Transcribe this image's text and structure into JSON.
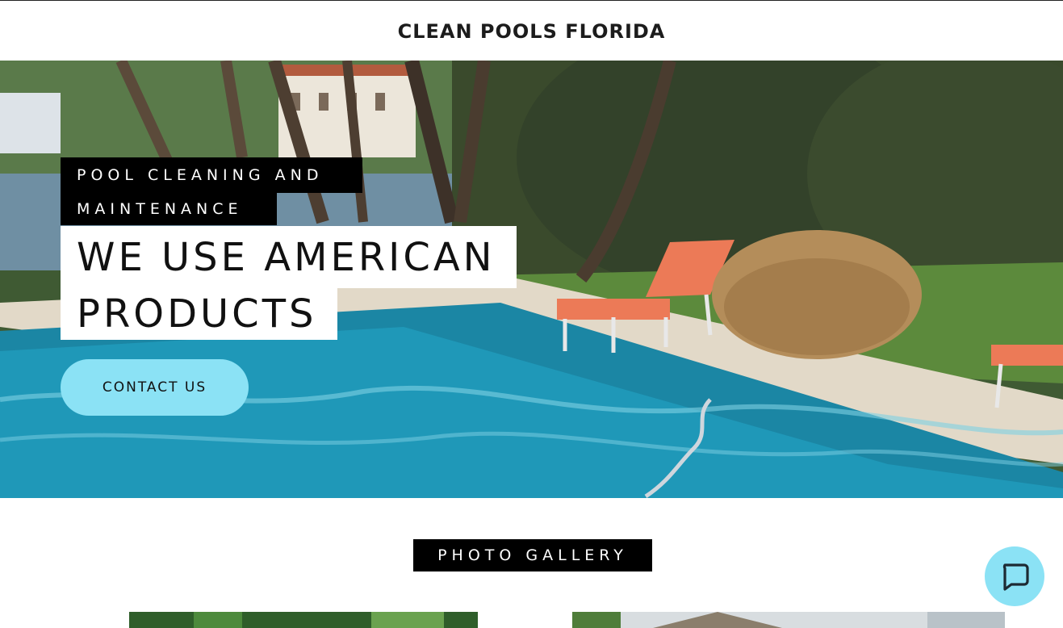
{
  "header": {
    "title": "CLEAN POOLS FLORIDA"
  },
  "hero": {
    "tagline_line1": "POOL CLEANING AND",
    "tagline_line2": "MAINTENANCE",
    "headline_line1": "WE USE AMERICAN",
    "headline_line2": "PRODUCTS",
    "cta_label": "CONTACT US",
    "background_image": "pool-backyard-photo"
  },
  "gallery": {
    "heading": "PHOTO GALLERY",
    "thumbnails": [
      "tropical-plants-photo",
      "house-roof-photo"
    ]
  },
  "chat": {
    "icon": "chat-bubble-icon"
  },
  "colors": {
    "accent": "#8be2f5",
    "label_bg": "#000000",
    "headline_bg": "#ffffff",
    "text": "#111111"
  }
}
